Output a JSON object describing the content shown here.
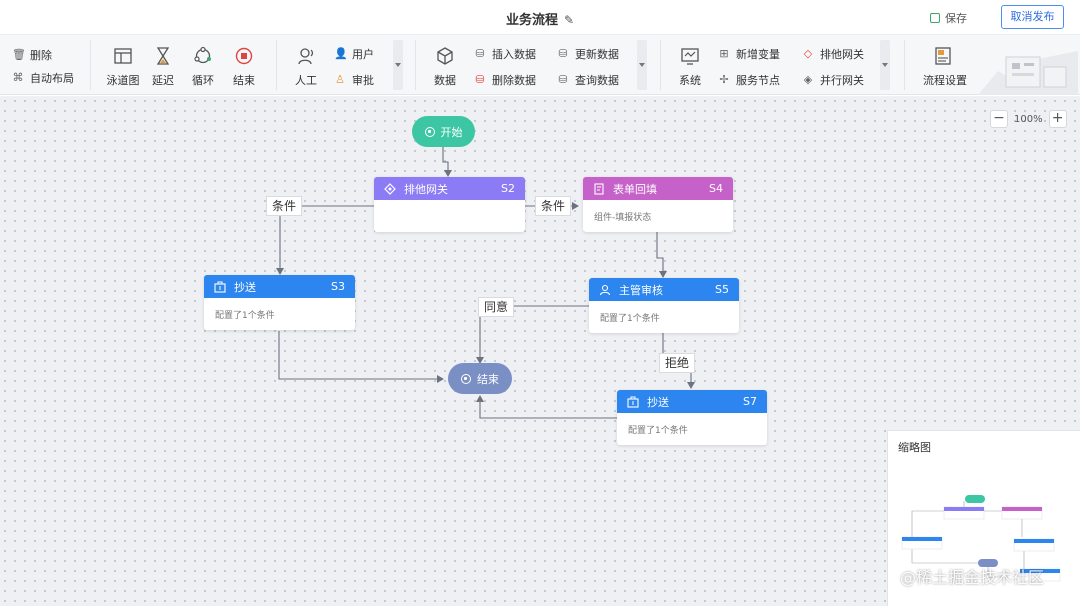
{
  "header": {
    "title": "业务流程",
    "edit_icon": "pencil-icon",
    "save_label": "保存",
    "cancel_publish_label": "取消发布"
  },
  "toolbar": {
    "delete_label": "删除",
    "auto_layout_label": "自动布局",
    "swimlane_label": "泳道图",
    "delay_label": "延迟",
    "loop_label": "循环",
    "end_label": "结束",
    "manual_label": "人工",
    "user_label": "用户",
    "approve_label": "审批",
    "data_label": "数据",
    "insert_data_label": "插入数据",
    "delete_data_label": "删除数据",
    "update_data_label": "更新数据",
    "query_data_label": "查询数据",
    "system_label": "系统",
    "new_variable_label": "新增变量",
    "service_node_label": "服务节点",
    "exclusive_gateway_label": "排他网关",
    "parallel_gateway_label": "并行网关",
    "flow_settings_label": "流程设置"
  },
  "zoom": {
    "value": "100%",
    "minus": "−",
    "plus": "+"
  },
  "nodes": {
    "start": {
      "label": "开始",
      "color": "#3cc6a4"
    },
    "end": {
      "label": "结束",
      "color": "#7a8fc4"
    },
    "s2": {
      "title": "排他网关",
      "id": "S2",
      "color": "#8b7cf6",
      "body": ""
    },
    "s4": {
      "title": "表单回填",
      "id": "S4",
      "color": "#c561c8",
      "body": "组件-填报状态"
    },
    "s3": {
      "title": "抄送",
      "id": "S3",
      "color": "#2d86f0",
      "body": "配置了1个条件"
    },
    "s5": {
      "title": "主管审核",
      "id": "S5",
      "color": "#2d86f0",
      "body": "配置了1个条件"
    },
    "s7": {
      "title": "抄送",
      "id": "S7",
      "color": "#2d86f0",
      "body": "配置了1个条件"
    }
  },
  "edge_labels": {
    "cond_left": "条件",
    "cond_right": "条件",
    "agree": "同意",
    "reject": "拒绝"
  },
  "minimap": {
    "title": "缩略图"
  },
  "watermark": "@稀土掘金技术社区"
}
